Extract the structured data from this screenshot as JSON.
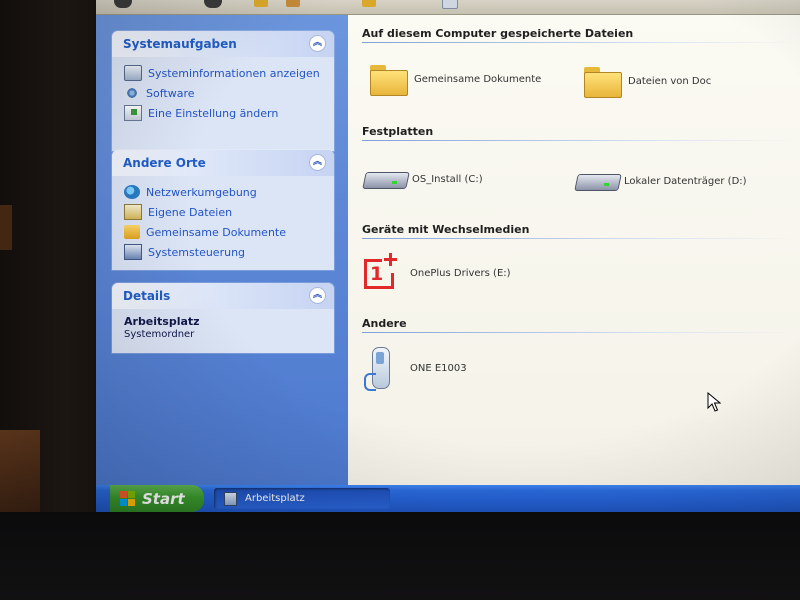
{
  "sidebar": {
    "system_tasks": {
      "title": "Systemaufgaben",
      "items": [
        {
          "label": "Systeminformationen anzeigen",
          "icon": "system-info-icon"
        },
        {
          "label": "Software",
          "icon": "software-icon"
        },
        {
          "label": "Eine Einstellung ändern",
          "icon": "settings-icon"
        }
      ]
    },
    "other_places": {
      "title": "Andere Orte",
      "items": [
        {
          "label": "Netzwerkumgebung",
          "icon": "network-icon"
        },
        {
          "label": "Eigene Dateien",
          "icon": "my-documents-icon"
        },
        {
          "label": "Gemeinsame Dokumente",
          "icon": "shared-documents-icon"
        },
        {
          "label": "Systemsteuerung",
          "icon": "control-panel-icon"
        }
      ]
    },
    "details": {
      "title": "Details",
      "name": "Arbeitsplatz",
      "type": "Systemordner"
    }
  },
  "content": {
    "stored_files": {
      "title": "Auf diesem Computer gespeicherte Dateien",
      "items": [
        "Gemeinsame Dokumente",
        "Dateien von Doc"
      ]
    },
    "hard_drives": {
      "title": "Festplatten",
      "items": [
        "OS_Install (C:)",
        "Lokaler Datenträger (D:)"
      ]
    },
    "removable": {
      "title": "Geräte mit Wechselmedien",
      "items": [
        "OnePlus Drivers (E:)"
      ]
    },
    "other": {
      "title": "Andere",
      "items": [
        "ONE E1003"
      ]
    }
  },
  "taskbar": {
    "start_label": "Start",
    "window_button_label": "Arbeitsplatz"
  },
  "colors": {
    "sidebar_blue": "#5e88d6",
    "link_blue": "#2154c4",
    "oneplus_red": "#e1292c",
    "start_green": "#3b9a2e",
    "taskbar_blue": "#245fd1"
  }
}
